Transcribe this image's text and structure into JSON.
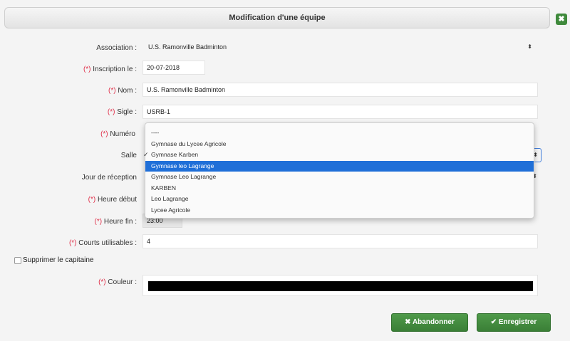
{
  "dialog": {
    "title": "Modification d'une équipe",
    "close_symbol": "✖"
  },
  "form": {
    "association": {
      "label": "Association :",
      "value": "U.S. Ramonville Badminton",
      "arrows": "⬍"
    },
    "inscription": {
      "req": "(*)",
      "label": "Inscription le :",
      "value": "20-07-2018"
    },
    "nom": {
      "req": "(*)",
      "label": "Nom :",
      "value": "U.S. Ramonville Badminton"
    },
    "sigle": {
      "req": "(*)",
      "label": "Sigle :",
      "value": "USRB-1"
    },
    "numero": {
      "req": "(*)",
      "label": "Numéro"
    },
    "salle": {
      "label": "Salle",
      "arrows": "⬍"
    },
    "jour": {
      "label": "Jour de réception",
      "arrows": "⬍"
    },
    "heure_debut": {
      "req": "(*)",
      "label": "Heure début"
    },
    "heure_fin": {
      "req": "(*)",
      "label": "Heure fin :",
      "value": "23:00"
    },
    "courts": {
      "req": "(*)",
      "label": "Courts utilisables :",
      "value": "4"
    },
    "supprimer": {
      "label": "Supprimer le capitaine"
    },
    "couleur": {
      "req": "(*)",
      "label": "Couleur :",
      "value": "#000000"
    }
  },
  "salle_dropdown": {
    "options": [
      "----",
      "Gymnase du Lycee Agricole",
      "Gymnase Karben",
      "Gymnase leo Lagrange",
      "Gymnase Leo Lagrange",
      "KARBEN",
      "Leo Lagrange",
      "Lycee Agricole"
    ],
    "checked_index": 2,
    "highlighted_index": 3,
    "check_symbol": "✓"
  },
  "buttons": {
    "abandonner": "✖ Abandonner",
    "enregistrer": "✔ Enregistrer"
  },
  "colors": {
    "accent_green": "#3f8a3c",
    "required_red": "#e0304a",
    "highlight_blue": "#1f6fd8"
  }
}
